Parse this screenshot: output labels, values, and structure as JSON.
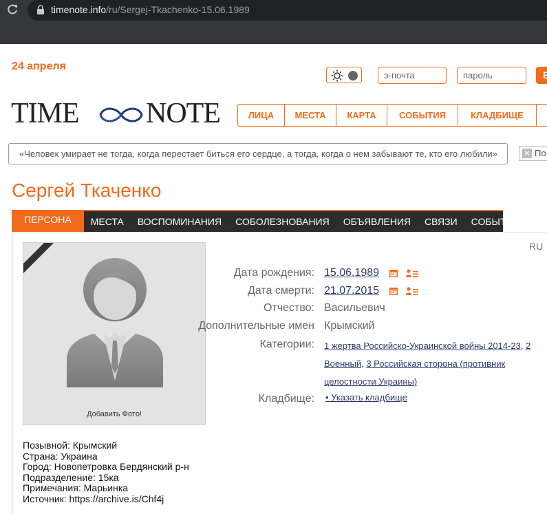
{
  "browser": {
    "url_host": "timenote.info",
    "url_path": "/ru/Sergej-Tkachenko-15.06.1989"
  },
  "header": {
    "date": "24 апреля",
    "email_placeholder": "э-почта",
    "password_placeholder": "пароль",
    "login_label": "В",
    "logo_left": "TIME",
    "logo_right": "NOTE",
    "nav": [
      "ЛИЦА",
      "МЕСТА",
      "КАРТА",
      "СОБЫТИЯ",
      "КЛАДБИЩЕ"
    ],
    "quote": "«Человек умирает не тогда, когда перестает биться его сердце, а тогда, когда о нем забывают те, кто его любили»",
    "chip_label": "По"
  },
  "person": {
    "name": "Сергей Ткаченко",
    "tabs": [
      "ПЕРСОНА",
      "МЕСТА",
      "ВОСПОМИНАНИЯ",
      "СОБОЛЕЗНОВАНИЯ",
      "ОБЪЯВЛЕНИЯ",
      "СВЯЗИ",
      "СОБЫТИЯ"
    ],
    "lang": "RU",
    "add_photo": "Добавить Фото!",
    "labels": {
      "birth": "Дата рождения:",
      "death": "Дата смерти:",
      "patronymic": "Отчество:",
      "additional_names": "Дополнительные имен",
      "categories": "Категории:",
      "cemetery": "Кладбище:"
    },
    "birth_date": "15.06.1989",
    "death_date": "21.07.2015",
    "patronymic": "Васильевич",
    "additional_names": "Крымский",
    "categories": [
      {
        "text": "1 жертва Российско-Украинской войны 2014-23",
        "sep": ", "
      },
      {
        "text": "2 Военный",
        "sep": ", "
      },
      {
        "text": "3 Российская сторона (противник целостности Украины)",
        "sep": ""
      }
    ],
    "cemetery_link": "• Указать кладбище",
    "details": [
      "Позывной: Крымский",
      "Страна: Украина",
      "Город: Новопетровка Бердянский р-н",
      "Подразделение: 15ка",
      "Примечания: Марьинка",
      "Источник: https://archive.is/Chf4j"
    ]
  },
  "colors": {
    "accent": "#f26b1d",
    "tabbar": "#2c2c2c",
    "link": "#2a3a6e"
  }
}
